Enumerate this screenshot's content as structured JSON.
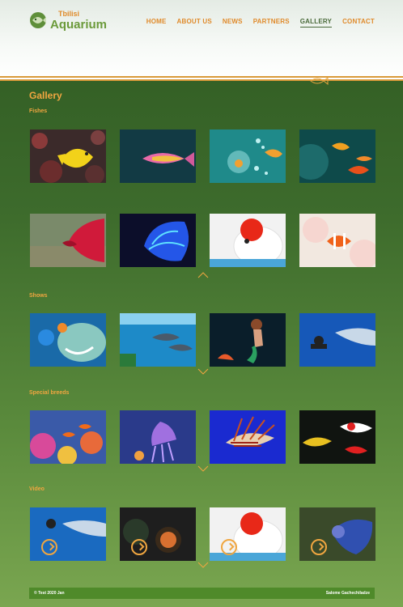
{
  "brand": {
    "small": "Tbilisi",
    "big": "Aquarium"
  },
  "nav": [
    {
      "label": "HOME",
      "active": false
    },
    {
      "label": "ABOUT US",
      "active": false
    },
    {
      "label": "NEWS",
      "active": false
    },
    {
      "label": "PARTNERS",
      "active": false
    },
    {
      "label": "GALLERY",
      "active": true
    },
    {
      "label": "CONTACT",
      "active": false
    }
  ],
  "page_title": "Gallery",
  "sections": {
    "fishes": "Fishes",
    "shows": "Shows",
    "special": "Special breeds",
    "video": "Video"
  },
  "footer": {
    "left": "© Test 2020 Jan",
    "right": "Salome Gachechiladze"
  },
  "colors": {
    "accent": "#e08a2a",
    "title": "#f0a640",
    "footer_bg": "#4f8a2a"
  }
}
